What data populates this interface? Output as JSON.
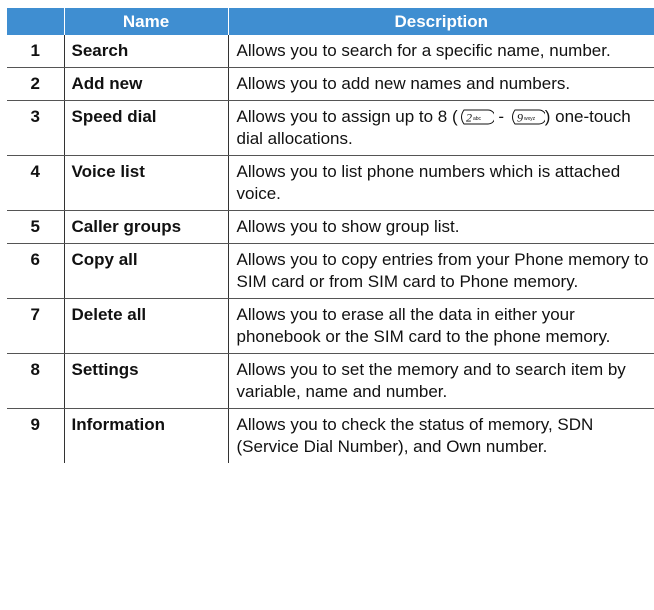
{
  "table": {
    "headers": [
      "",
      "Name",
      "Description"
    ],
    "rows": [
      {
        "num": "1",
        "name": "Search",
        "desc": "Allows you to search for a specific name, number."
      },
      {
        "num": "2",
        "name": "Add new",
        "desc": "Allows you to add new names and numbers."
      },
      {
        "num": "3",
        "name": "Speed dial",
        "desc_pre": "Allows you to assign up to 8 (",
        "key1": "2abc",
        "sep": " - ",
        "key2": "9wxyz",
        "desc_post": ") one-touch dial allocations."
      },
      {
        "num": "4",
        "name": "Voice list",
        "desc": "Allows you to list phone numbers which is attached voice."
      },
      {
        "num": "5",
        "name": "Caller groups",
        "desc": "Allows you to show group list."
      },
      {
        "num": "6",
        "name": "Copy all",
        "desc": "Allows you to copy entries from your Phone memory to SIM card or from SIM card to Phone memory."
      },
      {
        "num": "7",
        "name": "Delete all",
        "desc": "Allows you to erase all the data in either your phonebook or the SIM card to the phone memory."
      },
      {
        "num": "8",
        "name": "Settings",
        "desc": "Allows you to set the memory and to search item by variable, name and number."
      },
      {
        "num": "9",
        "name": "Information",
        "desc": "Allows you to check the status of memory, SDN (Service Dial Number), and Own number."
      }
    ]
  },
  "colors": {
    "header_bg": "#3f8ed1",
    "header_text": "#ffffff"
  },
  "icons": {
    "key1": "key-2-icon",
    "key2": "key-9-icon"
  }
}
